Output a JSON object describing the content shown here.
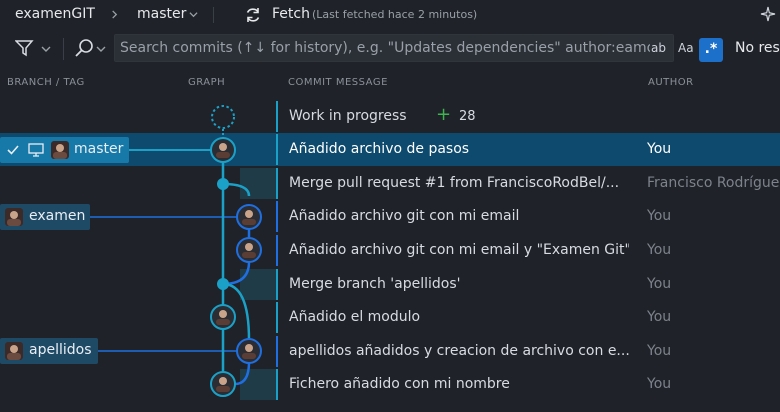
{
  "topbar": {
    "repo": "examenGIT",
    "branch": "master",
    "fetch_label": "Fetch",
    "fetch_status": "(Last fetched hace 2 minutos)"
  },
  "search": {
    "placeholder": "Search commits (↑↓ for history), e.g. \"Updates dependencies\" author:eamodio",
    "opt_words": "ab",
    "opt_case": "Aa",
    "opt_regex": ".*",
    "no_results": "No results"
  },
  "columns": {
    "branch": "BRANCH / TAG",
    "graph": "GRAPH",
    "message": "COMMIT MESSAGE",
    "author": "AUTHOR"
  },
  "wip": {
    "label": "Work in progress",
    "count": "28"
  },
  "branches": {
    "master": "master",
    "examen": "examen",
    "apellidos": "apellidos"
  },
  "commits": [
    {
      "message": "Añadido archivo de pasos",
      "author": "You"
    },
    {
      "message": "Merge pull request #1 from FranciscoRodBel/...",
      "author": "Francisco Rodríguez"
    },
    {
      "message": "Añadido archivo git con mi email",
      "author": "You"
    },
    {
      "message": "Añadido archivo git con mi email y \"Examen Git\"",
      "author": "You"
    },
    {
      "message": "Merge branch 'apellidos'",
      "author": "You"
    },
    {
      "message": "Añadido el modulo",
      "author": "You"
    },
    {
      "message": "apellidos añadidos y creacion de archivo con e...",
      "author": "You"
    },
    {
      "message": "Fichero añadido con mi nombre",
      "author": "You"
    }
  ],
  "colors": {
    "lane_main": "#1ba1c7",
    "lane_branch": "#1f6fe0",
    "selected_row": "#0d4a6d",
    "tag_selected": "#1779a8",
    "tag": "#1f4a66",
    "wip_plus": "#3fb34f"
  }
}
